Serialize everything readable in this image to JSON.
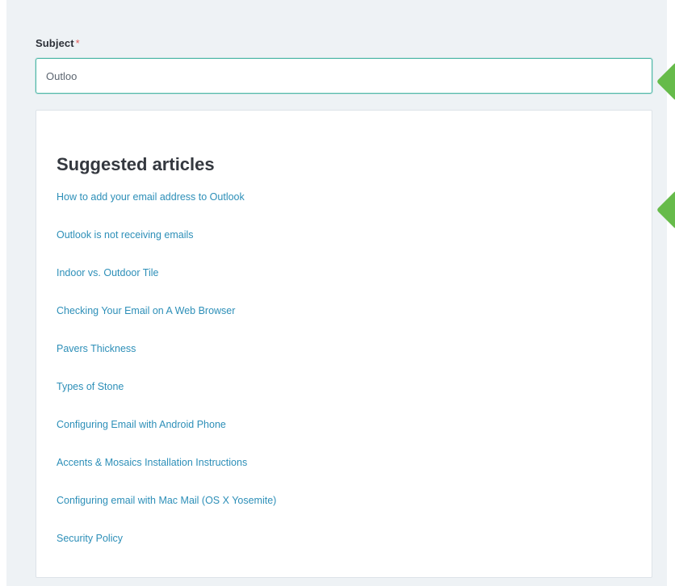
{
  "form": {
    "subject_label": "Subject",
    "required_marker": "*",
    "subject_value": "Outloo"
  },
  "suggestions": {
    "title": "Suggested articles",
    "articles": [
      "How to add your email address to Outlook",
      "Outlook is not receiving emails",
      "Indoor vs. Outdoor Tile",
      "Checking Your Email on A Web Browser",
      "Pavers Thickness",
      "Types of Stone",
      "Configuring Email with Android Phone",
      "Accents & Mosaics Installation Instructions",
      "Configuring email with Mac Mail (OS X Yosemite)",
      "Security Policy"
    ]
  },
  "colors": {
    "panel_background": "#eef2f5",
    "input_focus_border": "#4fb8a8",
    "link": "#2d8fb8",
    "required": "#e35b5b",
    "pointer_marker": "#66bb4a"
  }
}
